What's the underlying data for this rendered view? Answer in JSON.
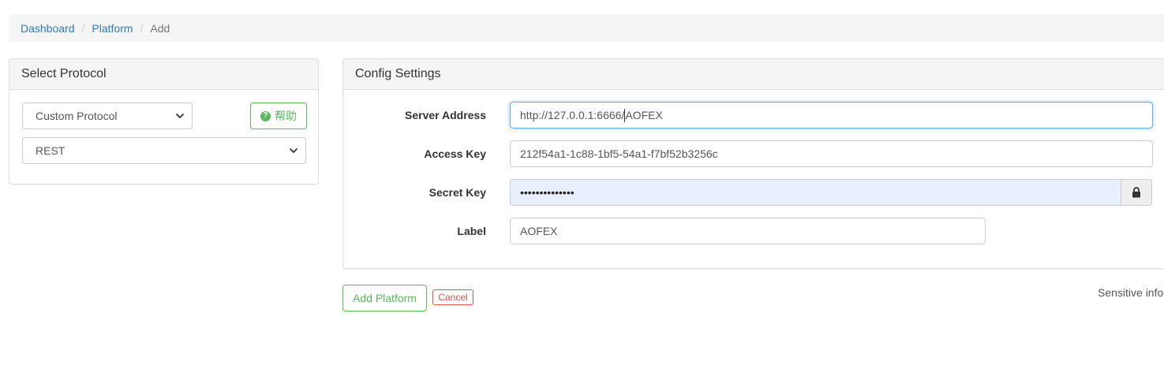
{
  "breadcrumb": {
    "items": [
      "Dashboard",
      "Platform"
    ],
    "active": "Add",
    "separator": "/"
  },
  "protocol_panel": {
    "title": "Select Protocol",
    "type_select": {
      "selected": "Custom Protocol"
    },
    "help_button": {
      "label": "帮助",
      "icon": "question-circle-icon"
    },
    "protocol_select": {
      "selected": "REST"
    }
  },
  "config_panel": {
    "title": "Config Settings",
    "fields": {
      "server_address": {
        "label": "Server Address",
        "value_before_caret": "http://127.0.0.1:6666/",
        "value_after_caret": "AOFEX"
      },
      "access_key": {
        "label": "Access Key",
        "value": "212f54a1-1c88-1bf5-54a1-f7bf52b3256c"
      },
      "secret_key": {
        "label": "Secret Key",
        "value": "••••••••••••••",
        "addon_icon": "lock-icon"
      },
      "label": {
        "label": "Label",
        "value": "AOFEX"
      }
    }
  },
  "actions": {
    "add_label": "Add Platform",
    "cancel_label": "Cancel"
  },
  "note": "Sensitive info",
  "colors": {
    "link": "#337ab7",
    "success": "#5cb85c",
    "danger": "#d9534f",
    "focus": "#66afe9",
    "autofill": "#e8f0fe"
  }
}
